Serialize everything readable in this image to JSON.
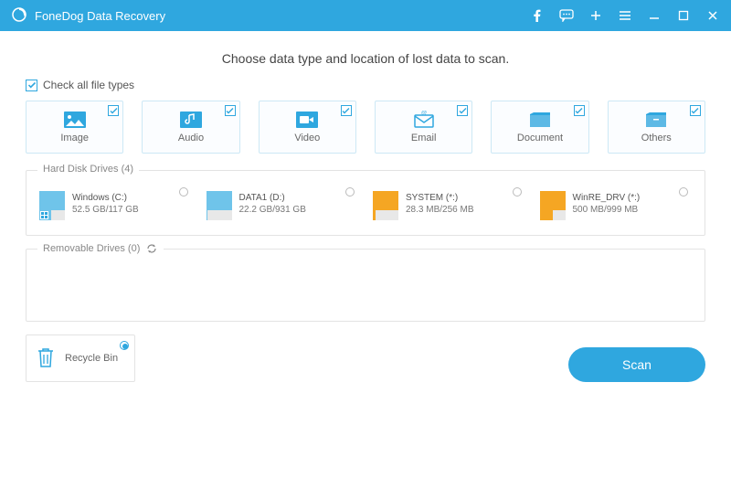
{
  "titlebar": {
    "title": "FoneDog Data Recovery"
  },
  "headline": "Choose data type and location of lost data to scan.",
  "checkall_label": "Check all file types",
  "types": [
    {
      "label": "Image"
    },
    {
      "label": "Audio"
    },
    {
      "label": "Video"
    },
    {
      "label": "Email"
    },
    {
      "label": "Document"
    },
    {
      "label": "Others"
    }
  ],
  "hdd": {
    "legend": "Hard Disk Drives (4)",
    "drives": [
      {
        "name": "Windows (C:)",
        "size": "52.5 GB/117 GB",
        "color": "#6fc4ea",
        "used_pct": 45,
        "badge": true
      },
      {
        "name": "DATA1 (D:)",
        "size": "22.2 GB/931 GB",
        "color": "#6fc4ea",
        "used_pct": 4,
        "badge": false
      },
      {
        "name": "SYSTEM (*:)",
        "size": "28.3 MB/256 MB",
        "color": "#f5a623",
        "used_pct": 12,
        "badge": false
      },
      {
        "name": "WinRE_DRV (*:)",
        "size": "500 MB/999 MB",
        "color": "#f5a623",
        "used_pct": 50,
        "badge": false
      }
    ]
  },
  "removable": {
    "legend": "Removable Drives (0)"
  },
  "recycle": {
    "label": "Recycle Bin"
  },
  "scan_label": "Scan"
}
